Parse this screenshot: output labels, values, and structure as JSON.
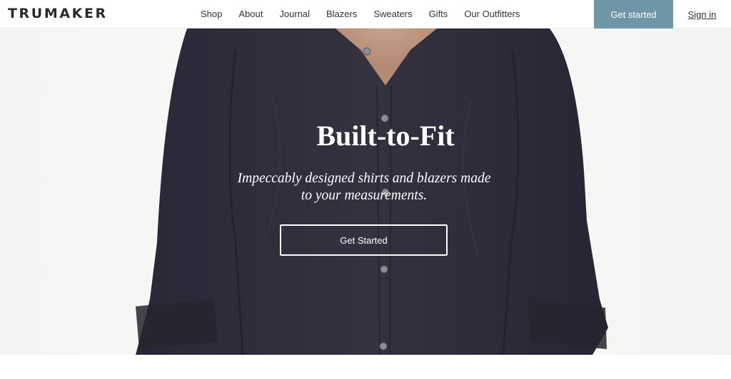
{
  "brand": {
    "logo_text": "TRUMAKER"
  },
  "nav": {
    "items": [
      {
        "label": "Shop"
      },
      {
        "label": "About"
      },
      {
        "label": "Journal"
      },
      {
        "label": "Blazers"
      },
      {
        "label": "Sweaters"
      },
      {
        "label": "Gifts"
      },
      {
        "label": "Our Outfitters"
      }
    ],
    "get_started_label": "Get started",
    "sign_in_label": "Sign in"
  },
  "hero": {
    "title": "Built-to-Fit",
    "subtitle": "Impeccably designed shirts and blazers made to your measurements.",
    "cta_label": "Get Started"
  },
  "colors": {
    "accent": "#6f96a7",
    "shirt": "#2f2d3d",
    "background": "#f5f5f3"
  },
  "icons": [
    "shirt-photo"
  ]
}
